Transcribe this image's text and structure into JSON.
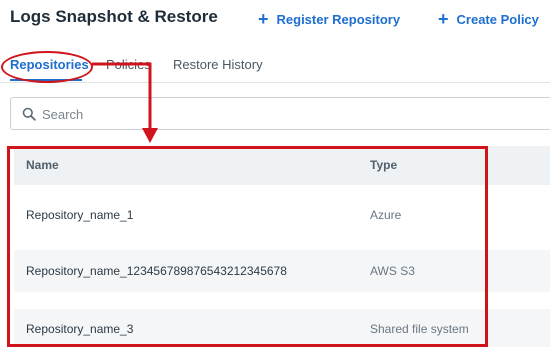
{
  "page": {
    "title": "Logs Snapshot & Restore"
  },
  "actions": {
    "register": "Register Repository",
    "create": "Create Policy"
  },
  "tabs": [
    {
      "label": "Repositories",
      "active": true
    },
    {
      "label": "Policies",
      "active": false
    },
    {
      "label": "Restore History",
      "active": false
    }
  ],
  "search": {
    "placeholder": "Search",
    "value": ""
  },
  "table": {
    "columns": {
      "name": "Name",
      "type": "Type"
    },
    "rows": [
      {
        "name": "Repository_name_1",
        "type": "Azure"
      },
      {
        "name": "Repository_name_12345678987654321234567​8",
        "type": "AWS S3"
      },
      {
        "name": "Repository_name_3",
        "type": "Shared file system"
      }
    ]
  },
  "colors": {
    "accent": "#1e6fd0",
    "annotation": "#d0141c",
    "header_row": "#eef2f5",
    "alt_row": "#f4f6f8"
  },
  "icons": {
    "search": "search-icon",
    "plus": "plus-icon",
    "arrow": "arrow-annotation-icon"
  }
}
